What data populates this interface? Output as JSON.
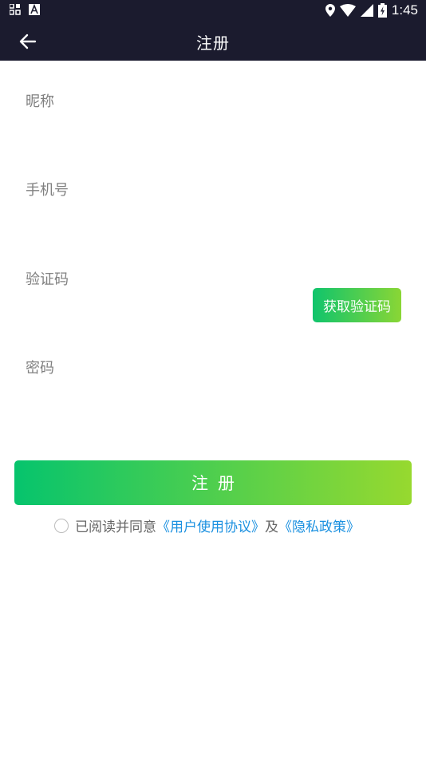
{
  "status_bar": {
    "time": "1:45",
    "icons": [
      "app-grid-icon",
      "a-box-icon",
      "location-icon",
      "wifi-icon",
      "signal-icon",
      "battery-charging-icon"
    ]
  },
  "app_bar": {
    "title": "注册",
    "back_icon": "arrow-left-icon"
  },
  "form": {
    "nickname": {
      "label": "昵称",
      "value": "",
      "placeholder": ""
    },
    "phone": {
      "label": "手机号",
      "value": "",
      "placeholder": ""
    },
    "code": {
      "label": "验证码",
      "value": "",
      "placeholder": "",
      "button_label": "获取验证码"
    },
    "password": {
      "label": "密码",
      "value": "",
      "placeholder": ""
    }
  },
  "register_button": {
    "label": "注册"
  },
  "agreement": {
    "checked": false,
    "prefix": "已阅读并同意",
    "user_agreement": "《用户使用协议》",
    "conjunction": "及",
    "privacy_policy": "《隐私政策》"
  },
  "colors": {
    "bar_background": "#1b1b2e",
    "gradient_start": "#06c46d",
    "gradient_end": "#97d92f",
    "link": "#1a90e0",
    "label": "#808080"
  }
}
